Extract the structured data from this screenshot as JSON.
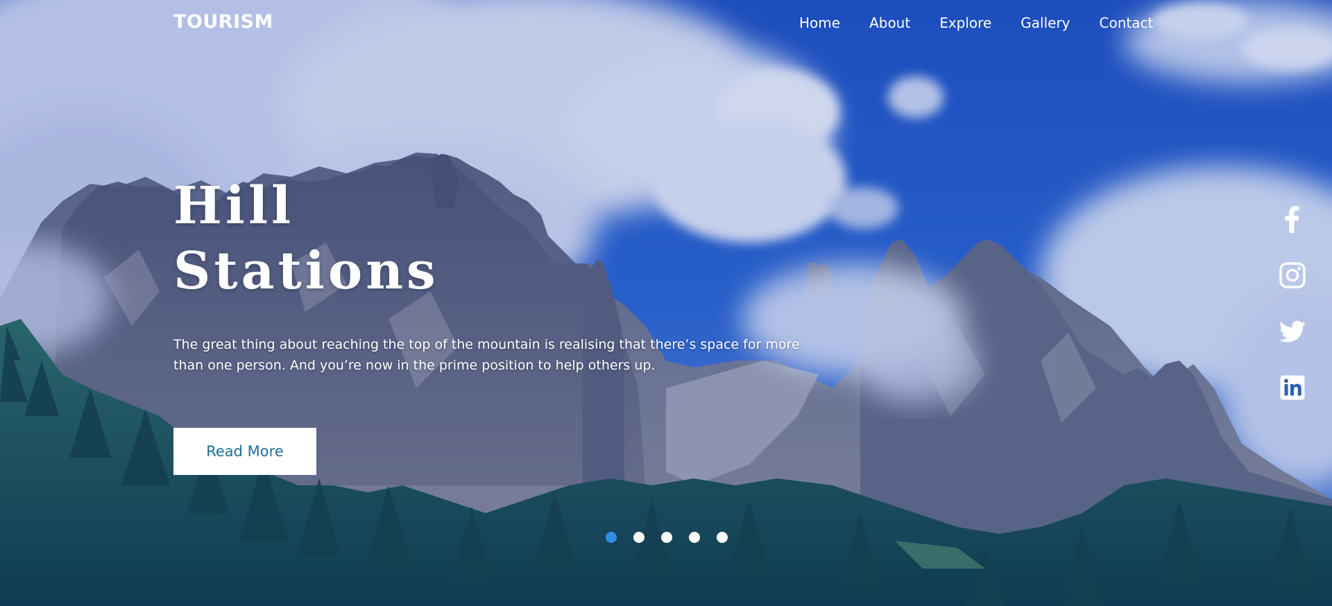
{
  "brand": {
    "logo": "TOURISM"
  },
  "nav": {
    "items": [
      {
        "label": "Home"
      },
      {
        "label": "About"
      },
      {
        "label": "Explore"
      },
      {
        "label": "Gallery"
      },
      {
        "label": "Contact"
      }
    ]
  },
  "hero": {
    "title_line1": "Hill",
    "title_line2": "Stations",
    "text_line1": "The great thing about reaching the top of the mountain is realising that there’s space for more",
    "text_line2": "than one person. And you’re now in the prime position to help others up.",
    "button_label": "Read More"
  },
  "slider": {
    "count": 5,
    "active_index": 0
  },
  "social": {
    "icons": [
      "facebook-icon",
      "instagram-icon",
      "twitter-icon",
      "linkedin-icon"
    ]
  },
  "colors": {
    "accent": "#2f8fe6",
    "button_text": "#1a6f9c",
    "sky": "#1b4fb8"
  }
}
